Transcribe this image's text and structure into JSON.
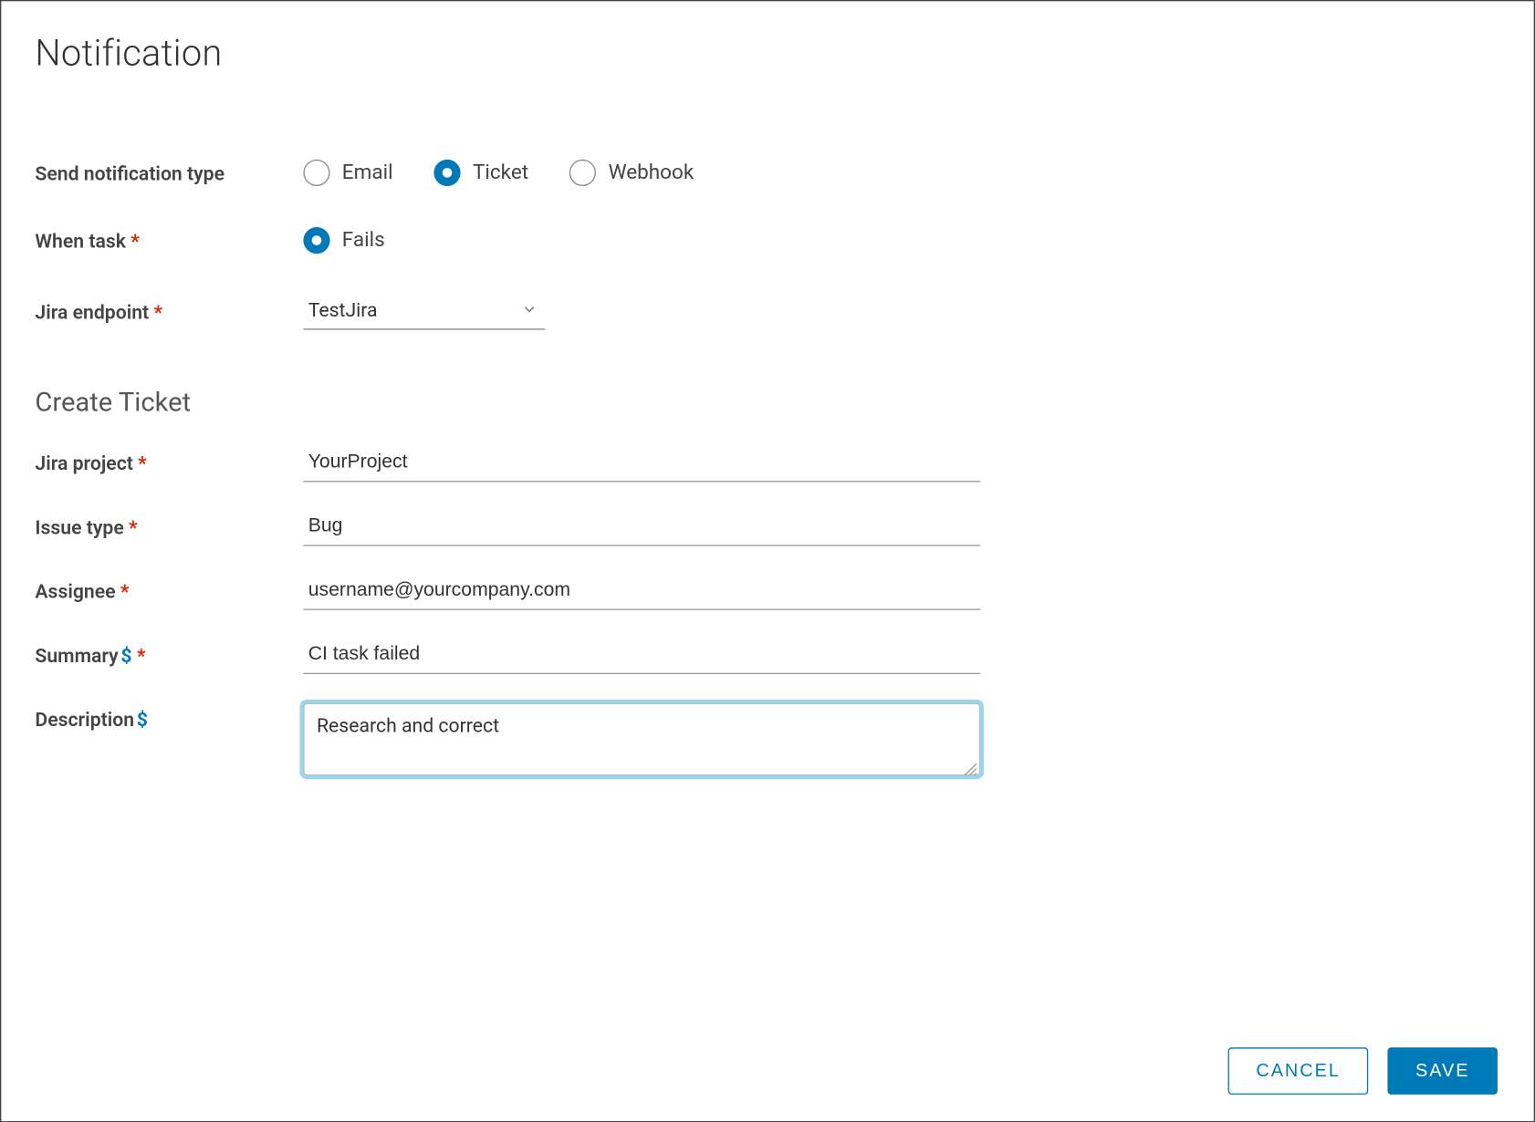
{
  "title": "Notification",
  "labels": {
    "send_type": "Send notification type",
    "when_task": "When task",
    "jira_endpoint": "Jira endpoint",
    "create_ticket": "Create Ticket",
    "jira_project": "Jira project",
    "issue_type": "Issue type",
    "assignee": "Assignee",
    "summary": "Summary",
    "description": "Description"
  },
  "send_type_options": {
    "email": "Email",
    "ticket": "Ticket",
    "webhook": "Webhook"
  },
  "send_type_selected": "ticket",
  "when_task_options": {
    "fails": "Fails"
  },
  "when_task_selected": "fails",
  "jira_endpoint_value": "TestJira",
  "fields": {
    "jira_project": "YourProject",
    "issue_type": "Bug",
    "assignee": "username@yourcompany.com",
    "summary": "CI task failed",
    "description": "Research and correct"
  },
  "buttons": {
    "cancel": "Cancel",
    "save": "Save"
  }
}
